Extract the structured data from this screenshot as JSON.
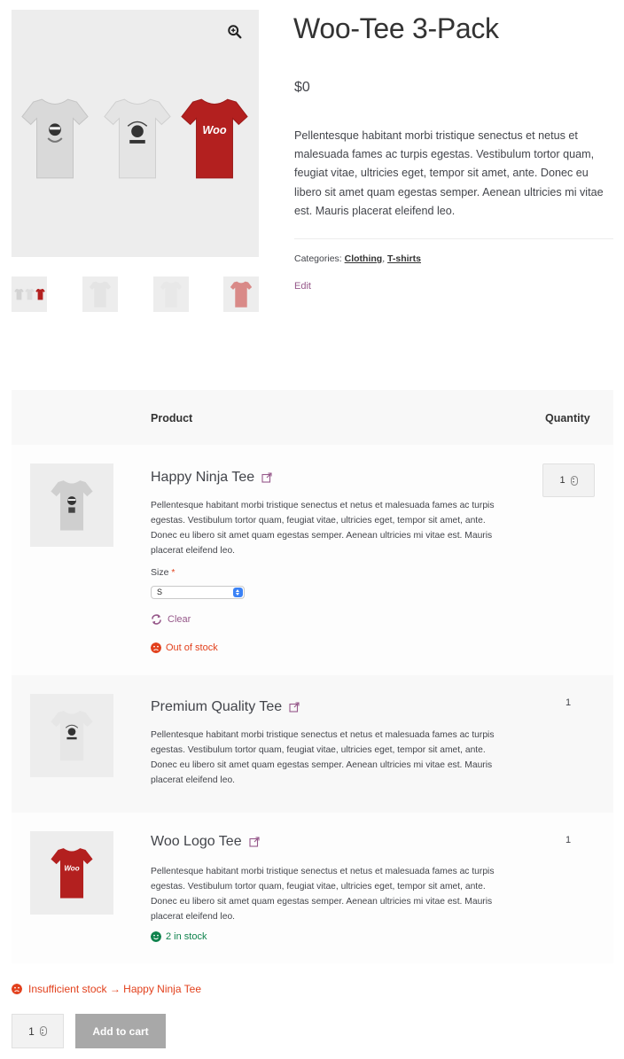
{
  "product": {
    "title": "Woo-Tee 3-Pack",
    "price": "$0",
    "description": "Pellentesque habitant morbi tristique senectus et netus et malesuada fames ac turpis egestas. Vestibulum tortor quam, feugiat vitae, ultricies eget, tempor sit amet, ante. Donec eu libero sit amet quam egestas semper. Aenean ultricies mi vitae est. Mauris placerat eleifend leo.",
    "categories_label": "Categories:",
    "categories": [
      "Clothing",
      "T-shirts"
    ],
    "category_separator": ", ",
    "edit_label": "Edit"
  },
  "gallery": {
    "zoom_icon": "zoom-in-icon",
    "main_shirts": [
      {
        "color": "#d9d9d9",
        "print": "ninja"
      },
      {
        "color": "#e4e4e4",
        "print": "northerner"
      },
      {
        "color": "#b3201f",
        "print": "woo"
      }
    ],
    "thumbnails": [
      {
        "colors": [
          "#d3d3d3",
          "#dedede",
          "#b3201f"
        ]
      },
      {
        "colors": [
          "#e4e4e4"
        ]
      },
      {
        "colors": [
          "#e8e8e8"
        ]
      },
      {
        "colors": [
          "#d98a88"
        ]
      }
    ],
    "print_text": "Woo"
  },
  "bundle": {
    "header_product": "Product",
    "header_quantity": "Quantity",
    "items": [
      {
        "title": "Happy Ninja Tee",
        "description": "Pellentesque habitant morbi tristique senectus et netus et malesuada fames ac turpis egestas. Vestibulum tortor quam, feugiat vitae, ultricies eget, tempor sit amet, ante. Donec eu libero sit amet quam egestas semper. Aenean ultricies mi vitae est. Mauris placerat eleifend leo.",
        "size_label": "Size",
        "required_mark": "*",
        "size_value": "S",
        "clear_label": "Clear",
        "stock_text": "Out of stock",
        "quantity": "1",
        "shirt_color": "#cfcfcf"
      },
      {
        "title": "Premium Quality Tee",
        "description": "Pellentesque habitant morbi tristique senectus et netus et malesuada fames ac turpis egestas. Vestibulum tortor quam, feugiat vitae, ultricies eget, tempor sit amet, ante. Donec eu libero sit amet quam egestas semper. Aenean ultricies mi vitae est. Mauris placerat eleifend leo.",
        "quantity": "1",
        "shirt_color": "#e6e6e6"
      },
      {
        "title": "Woo Logo Tee",
        "description": "Pellentesque habitant morbi tristique senectus et netus et malesuada fames ac turpis egestas. Vestibulum tortor quam, feugiat vitae, ultricies eget, tempor sit amet, ante. Donec eu libero sit amet quam egestas semper. Aenean ultricies mi vitae est. Mauris placerat eleifend leo.",
        "stock_text": "2 in stock",
        "quantity": "1",
        "shirt_color": "#b3201f"
      }
    ]
  },
  "cart": {
    "error_text": "Insufficient stock → Happy Ninja Tee",
    "quantity": "1",
    "add_to_cart_label": "Add to cart"
  },
  "colors": {
    "link_purple": "#96588a",
    "error_red": "#e2401c",
    "success_green": "#0f834d",
    "button_disabled_gray": "#a8a8a8"
  }
}
